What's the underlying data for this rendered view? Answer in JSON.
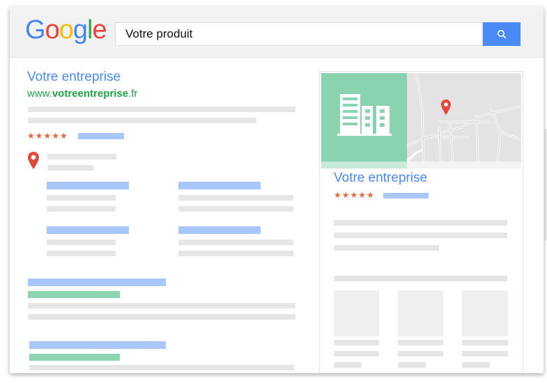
{
  "header": {
    "logo": {
      "letters": [
        {
          "ch": "G",
          "color": "#4285F4"
        },
        {
          "ch": "o",
          "color": "#EA4335"
        },
        {
          "ch": "o",
          "color": "#FBBC05"
        },
        {
          "ch": "g",
          "color": "#4285F4"
        },
        {
          "ch": "l",
          "color": "#34A853"
        },
        {
          "ch": "e",
          "color": "#EA4335"
        }
      ]
    },
    "search": {
      "value": "Votre produit",
      "button_icon": "search-icon",
      "button_color": "#4a8af4"
    }
  },
  "result": {
    "title": "Votre entreprise",
    "url_prefix": "www.",
    "url_domain": "votreentreprise",
    "url_suffix": ".fr",
    "stars": "★★★★★",
    "location_icon": "map-pin-icon"
  },
  "knowledge_panel": {
    "title": "Votre entreprise",
    "stars": "★★★★★",
    "image_icon": "building-icon",
    "map_pin_icon": "map-pin-icon"
  },
  "colors": {
    "link_blue": "#4a8af4",
    "url_green": "#1ea446",
    "star_orange": "#e8663d",
    "pin_red": "#e4483a",
    "panel_green": "#89d3b0"
  }
}
